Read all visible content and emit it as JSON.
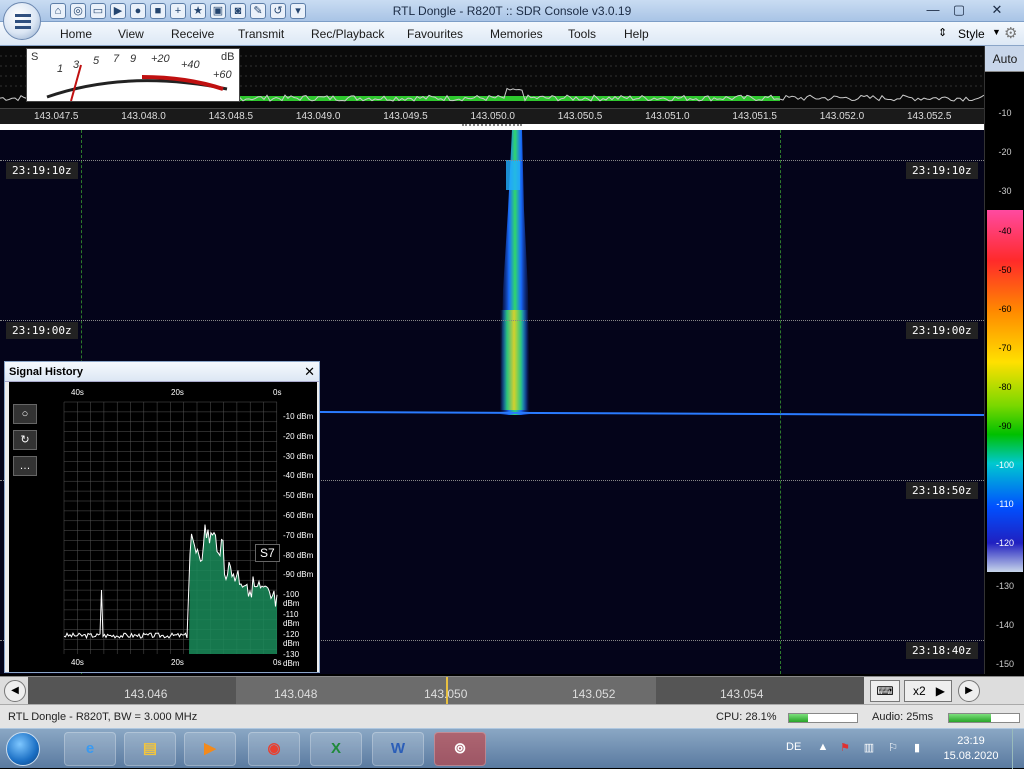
{
  "window": {
    "title": "RTL Dongle - R820T :: SDR Console v3.0.19",
    "min_glyph": "—",
    "max_glyph": "▢",
    "close_glyph": "✕"
  },
  "quick_access_icons": [
    "home-icon",
    "lifebuoy-icon",
    "folder-icon",
    "play-icon",
    "record-icon",
    "stop-icon",
    "plus-icon",
    "star-icon",
    "lock-icon",
    "camera-icon",
    "wrench-icon",
    "undo-icon",
    "dropdown-icon"
  ],
  "ribbon": {
    "menus": [
      "Home",
      "View",
      "Receive",
      "Transmit",
      "Rec/Playback",
      "Favourites",
      "Memories",
      "Tools",
      "Help"
    ],
    "style_label": "Style"
  },
  "smeter": {
    "labels": [
      "S",
      "1",
      "3",
      "5",
      "7",
      "9",
      "+20",
      "+40",
      "+60",
      "dB"
    ],
    "reading": "S7"
  },
  "freq_axis": [
    "143.047.5",
    "143.048.0",
    "143.048.5",
    "143.049.0",
    "143.049.5",
    "143.050.0",
    "143.050.5",
    "143.051.0",
    "143.051.5",
    "143.052.0",
    "143.052.5"
  ],
  "timestamps": [
    "23:19:10z",
    "23:19:00z",
    "23:18:50z",
    "23:18:40z"
  ],
  "db_scale": {
    "auto_label": "Auto",
    "labels": [
      "-10",
      "-20",
      "-30"
    ],
    "colorbar_labels": [
      "-40",
      "-50",
      "-60",
      "-70",
      "-80",
      "-90",
      "-100",
      "-110",
      "-120"
    ],
    "bottom_labels": [
      "-130",
      "-140",
      "-150"
    ]
  },
  "signal_history": {
    "title": "Signal History",
    "close_glyph": "✕",
    "time_labels_top": [
      "40s",
      "20s",
      "0s"
    ],
    "time_labels_bottom": [
      "40s",
      "20s",
      "0s"
    ],
    "dbm_labels": [
      "-10 dBm",
      "-20 dBm",
      "-30 dBm",
      "-40 dBm",
      "-50 dBm",
      "-60 dBm",
      "-70 dBm",
      "-80 dBm",
      "-90 dBm",
      "-100 dBm",
      "-110 dBm",
      "-120 dBm",
      "-130 dBm"
    ],
    "s_reading": "S7",
    "tools": [
      "circle-tool-icon",
      "refresh-tool-icon",
      "more-tool-icon"
    ]
  },
  "band": {
    "labels": [
      "143.046",
      "143.048",
      "143.050",
      "143.052",
      "143.054"
    ],
    "x2_label": "x2"
  },
  "status": {
    "device": "RTL Dongle - R820T, BW = 3.000 MHz",
    "cpu": "CPU: 28.1%",
    "cpu_value": 28.1,
    "audio": "Audio: 25ms",
    "audio_level": 0.6
  },
  "taskbar": {
    "apps": [
      "ie-icon",
      "explorer-icon",
      "media-player-icon",
      "chrome-icon",
      "excel-icon",
      "word-icon",
      "sdr-console-icon"
    ],
    "lang": "DE",
    "time": "23:19",
    "date": "15.08.2020"
  },
  "colors": {
    "accent": "#c8d6ea",
    "waterfall_bg": "#04041a",
    "spectrum_green": "#2ec82e"
  }
}
